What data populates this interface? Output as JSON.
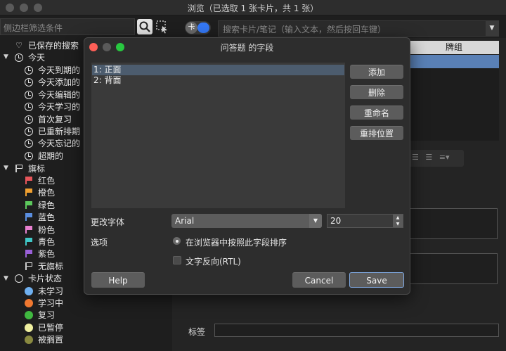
{
  "window": {
    "title": "浏览（已选取 1 张卡片，共 1 张）"
  },
  "toolbar": {
    "sidebar_filter_placeholder": "侧边栏筛选条件",
    "toggle_label": "卡",
    "search_placeholder": "搜索卡片/笔记（输入文本，然后按回车键）"
  },
  "sidebar": {
    "saved_searches": "已保存的搜索",
    "today": "今天",
    "today_items": [
      "今天到期的",
      "今天添加的",
      "今天编辑的",
      "今天学习的",
      "首次复习",
      "已重新排期",
      "今天忘记的",
      "超期的"
    ],
    "flags": "旗标",
    "flag_items": [
      {
        "label": "红色",
        "color": "#e8555a"
      },
      {
        "label": "橙色",
        "color": "#f0a030"
      },
      {
        "label": "绿色",
        "color": "#5cc85c"
      },
      {
        "label": "蓝色",
        "color": "#5a8ee0"
      },
      {
        "label": "粉色",
        "color": "#e880d0"
      },
      {
        "label": "青色",
        "color": "#40c8c8"
      },
      {
        "label": "紫色",
        "color": "#9a60d8"
      },
      {
        "label": "无旗标",
        "color": ""
      }
    ],
    "card_state": "卡片状态",
    "state_items": [
      {
        "label": "未学习",
        "color": "#6fb0f0"
      },
      {
        "label": "学习中",
        "color": "#f07830"
      },
      {
        "label": "复习",
        "color": "#40b840"
      },
      {
        "label": "已暂停",
        "color": "#f0f0a0"
      },
      {
        "label": "被搁置",
        "color": "#8a8a40"
      }
    ]
  },
  "browser": {
    "deck_column": "牌组",
    "tags_label": "标签"
  },
  "dialog": {
    "title": "问答题 的字段",
    "fields": [
      "1: 正面",
      "2: 背面"
    ],
    "buttons": {
      "add": "添加",
      "delete": "删除",
      "rename": "重命名",
      "reorder": "重排位置"
    },
    "change_font_label": "更改字体",
    "font_value": "Arial",
    "font_size": "20",
    "options_label": "选项",
    "sort_option": "在浏览器中按照此字段排序",
    "rtl_option": "文字反向(RTL)",
    "help": "Help",
    "cancel": "Cancel",
    "save": "Save"
  }
}
